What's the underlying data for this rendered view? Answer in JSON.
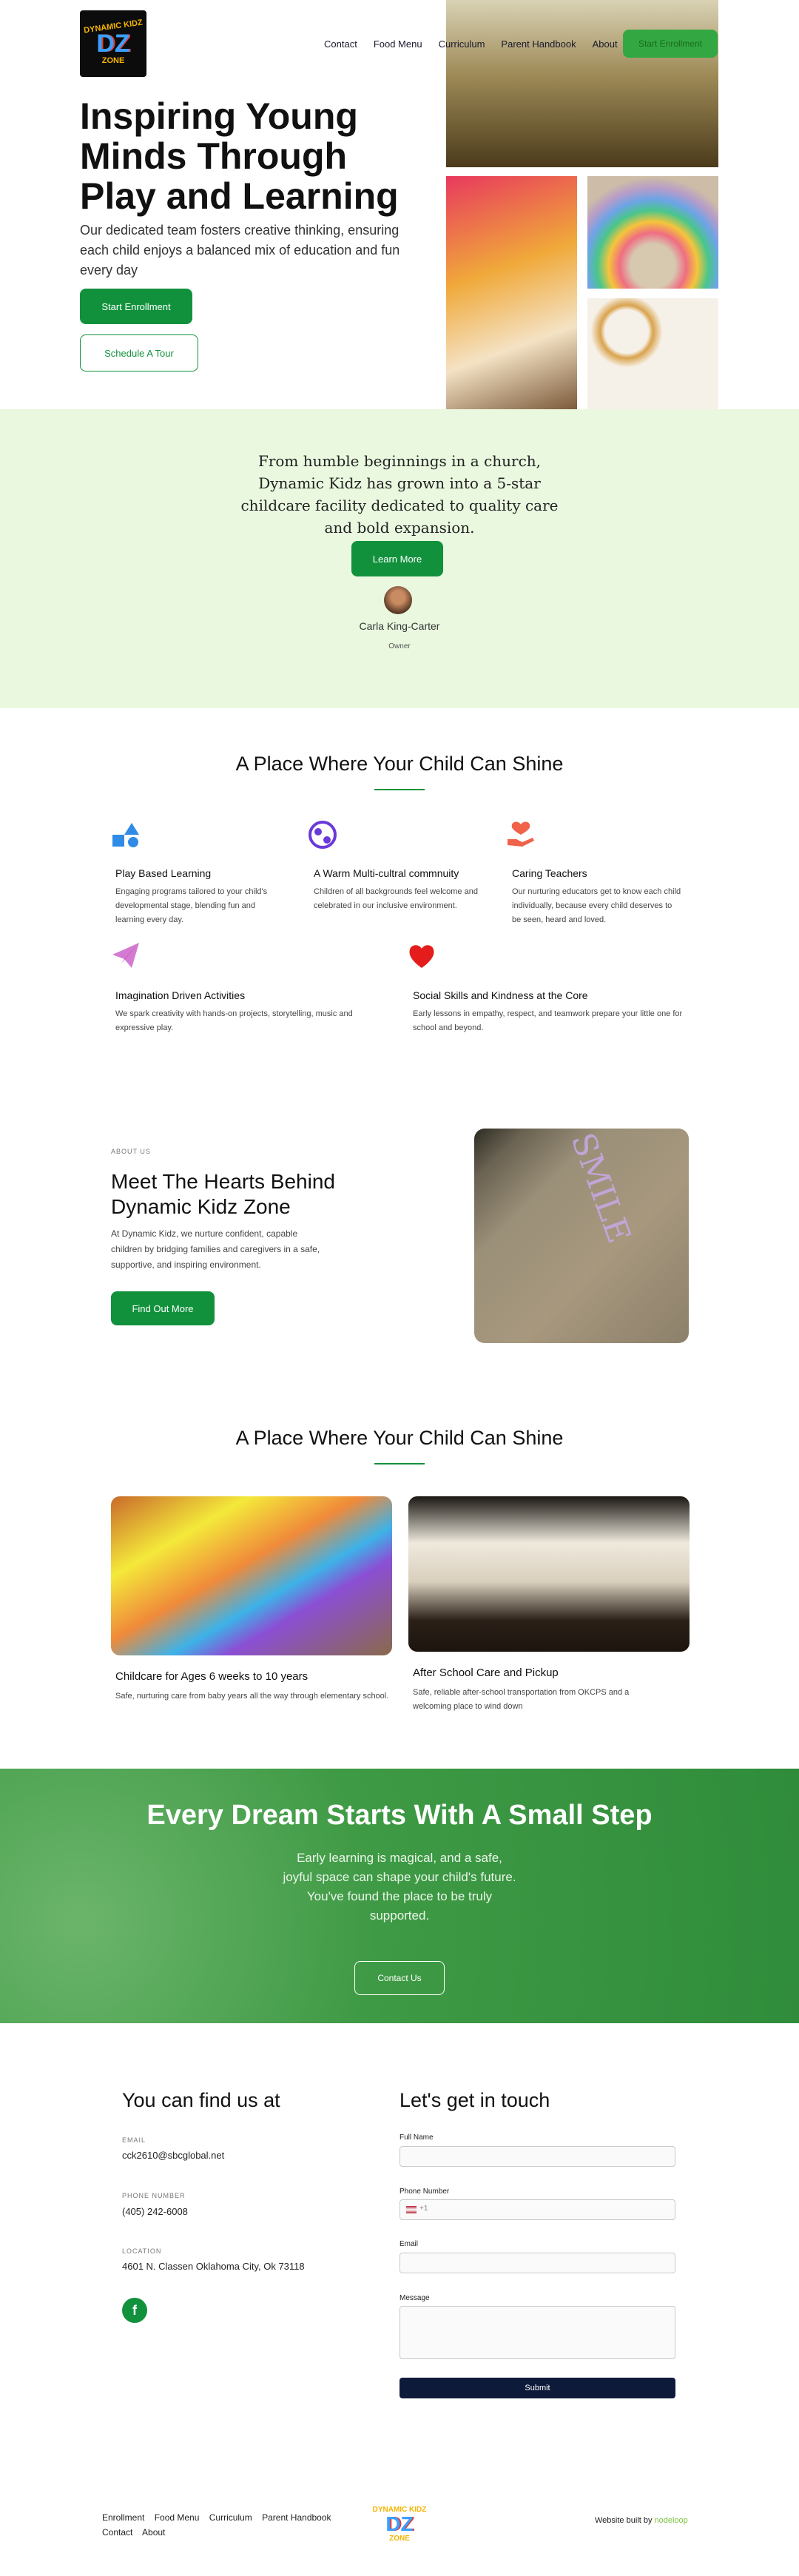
{
  "brand": {
    "logo_line1": "DYNAMIC KIDZ",
    "logo_mark": "DZ",
    "logo_line2": "ZONE"
  },
  "nav": {
    "items": [
      "Contact",
      "Food Menu",
      "Curriculum",
      "Parent Handbook",
      "About"
    ],
    "cta": "Start Enrollment"
  },
  "hero": {
    "title": "Inspiring Young Minds Through Play and Learning",
    "subtitle": "Our dedicated team fosters creative thinking, ensuring each child enjoys a balanced mix of education and fun every day",
    "primary_button": "Start Enrollment",
    "secondary_button": "Schedule A Tour"
  },
  "intro": {
    "text": "From humble beginnings in a church, Dynamic Kidz has grown into a 5-star childcare facility dedicated to quality care and bold expansion.",
    "button": "Learn More",
    "owner_name": "Carla King-Carter",
    "owner_role": "Owner"
  },
  "features": {
    "title": "A Place Where Your Child Can Shine",
    "items": [
      {
        "icon": "shapes-icon",
        "title": "Play Based Learning",
        "desc": "Engaging programs tailored to your child's developmental stage, blending fun and learning every day."
      },
      {
        "icon": "globe-icon",
        "title": "A Warm Multi-cultral commnuity",
        "desc": "Children of all backgrounds feel welcome and celebrated in our inclusive environment."
      },
      {
        "icon": "caring-hand-icon",
        "title": "Caring Teachers",
        "desc": "Our nurturing educators get to know each child individually, because every child deserves to be seen, heard and loved."
      },
      {
        "icon": "paper-plane-icon",
        "title": "Imagination Driven Activities",
        "desc": "We spark creativity with hands-on projects, storytelling, music and expressive play."
      },
      {
        "icon": "heart-icon",
        "title": "Social Skills and Kindness at the Core",
        "desc": "Early lessons in empathy, respect, and teamwork prepare your little one for school and beyond."
      }
    ]
  },
  "about": {
    "kicker": "ABOUT US",
    "title": "Meet The Hearts Behind Dynamic Kidz Zone",
    "desc": "At Dynamic Kidz, we nurture confident, capable children by bridging families and caregivers in a safe, supportive, and inspiring environment.",
    "button": "Find Out More",
    "chalk_text": "SMILE"
  },
  "programs": {
    "title": "A Place Where Your Child Can Shine",
    "items": [
      {
        "title": "Childcare for Ages 6 weeks to 10 years",
        "desc": "Safe, nurturing care from baby years all the way through elementary school."
      },
      {
        "title": "After School Care and Pickup",
        "desc": "Safe, reliable after-school transportation from OKCPS and a welcoming place to wind down"
      }
    ]
  },
  "cta": {
    "title": "Every Dream Starts With A Small Step",
    "desc": "Early learning is magical, and a safe, joyful space can shape your child's future. You've found the place to be truly supported.",
    "button": "Contact Us"
  },
  "contact": {
    "heading": "You can find us at",
    "email_label": "EMAIL",
    "email": "cck2610@sbcglobal.net",
    "phone_label": "PHONE NUMBER",
    "phone": "(405) 242-6008",
    "location_label": "LOCATION",
    "location": "4601 N. Classen Oklahoma City, Ok 73118"
  },
  "form": {
    "heading": "Let's get in touch",
    "full_name_label": "Full Name",
    "phone_label": "Phone Number",
    "phone_prefix": "+1",
    "email_label": "Email",
    "message_label": "Message",
    "submit": "Submit"
  },
  "footer": {
    "links": [
      "Enrollment",
      "Food Menu",
      "Curriculum",
      "Parent Handbook",
      "Contact",
      "About"
    ],
    "credit_prefix": "Website built by",
    "credit_name": "nodeloop"
  },
  "colors": {
    "accent": "#12913d",
    "intro_bg": "#e9f8df",
    "cta_bg": "#3f9a45",
    "submit_bg": "#0e1a3a"
  }
}
